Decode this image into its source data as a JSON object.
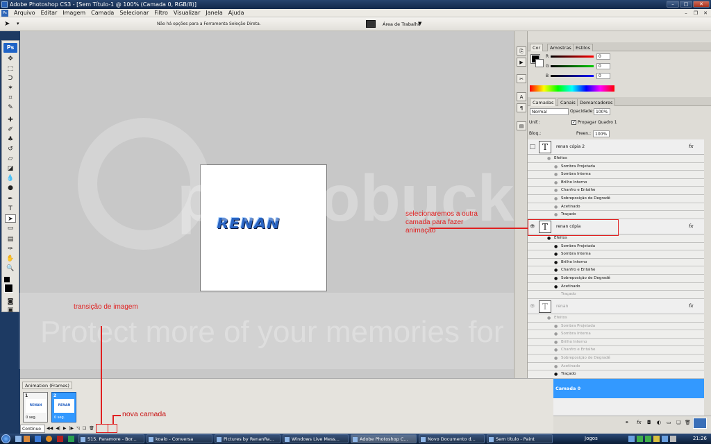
{
  "window": {
    "title": "Adobe Photoshop CS3 - [Sem Título-1 @ 100% (Camada 0, RGB/8)]",
    "min_label": "–",
    "max_label": "□",
    "close_label": "✕"
  },
  "menu": {
    "items": [
      "Arquivo",
      "Editar",
      "Imagem",
      "Camada",
      "Selecionar",
      "Filtro",
      "Visualizar",
      "Janela",
      "Ajuda"
    ]
  },
  "options_bar": {
    "message": "Não há opções para a Ferramenta Seleção Direta.",
    "workspace_label": "Área de Trabalho"
  },
  "toolbar": {
    "logo": "Ps"
  },
  "document": {
    "logo_text": "RENAN"
  },
  "watermark": {
    "main": "photobucket",
    "protect": "Protect more of your memories for less!"
  },
  "annotations": {
    "transition": "transição de imagem",
    "new_layer": "nova camada",
    "select_layer": "selecionaremos a outra camada para fazer animação"
  },
  "color_panel": {
    "tabs": [
      "Cor",
      "Amostras",
      "Estilos"
    ],
    "channels": [
      {
        "label": "R",
        "value": "0",
        "color": "#ff0000"
      },
      {
        "label": "G",
        "value": "0",
        "color": "#00c000"
      },
      {
        "label": "B",
        "value": "0",
        "color": "#0000ff"
      }
    ]
  },
  "layers_panel": {
    "tabs": [
      "Camadas",
      "Canais",
      "Demarcadores"
    ],
    "blend_mode": "Normal",
    "opacity_label": "Opacidade:",
    "opacity_value": "100%",
    "unify_label": "Unif.:",
    "propagate_label": "Propagar Quadro 1",
    "lock_label": "Bloq.:",
    "fill_label": "Preen.:",
    "fill_value": "100%",
    "layers": [
      {
        "name": "renan cópia 2",
        "fx": "fx",
        "effects_label": "Efeitos",
        "effects": [
          "Sombra Projetada",
          "Sombra Interna",
          "Brilho Interno",
          "Chanfro e Entalhe",
          "Sobreposição de Degradê",
          "Acetinado",
          "Traçado"
        ]
      },
      {
        "name": "renan cópia",
        "fx": "fx",
        "effects_label": "Efeitos",
        "effects": [
          "Sombra Projetada",
          "Sombra Interna",
          "Brilho Interno",
          "Chanfro e Entalhe",
          "Sobreposição de Degradê",
          "Acetinado",
          "Traçado"
        ]
      },
      {
        "name": "renan",
        "fx": "fx",
        "effects_label": "Efeitos",
        "effects": [
          "Sombra Projetada",
          "Sombra Interna",
          "Brilho Interno",
          "Chanfro e Entalhe",
          "Sobreposição de Degradê",
          "Acetinado",
          "Traçado"
        ]
      }
    ],
    "selected_layer": "Camada 0",
    "selected_color": "#3399ff"
  },
  "animation_panel": {
    "tab": "Animation (Frames)",
    "frames": [
      {
        "num": "1",
        "time": "0 seg.",
        "thumb": "RENAN"
      },
      {
        "num": "2",
        "time": "0 seg.",
        "thumb": "RENAN"
      }
    ],
    "loop": "Contínuo"
  },
  "taskbar": {
    "items": [
      "515. Paramore - Bor...",
      "koalo - Conversa",
      "Pictures by RenanRa...",
      "Windows Live Mess...",
      "Adobe Photoshop C...",
      "Novo Documento d...",
      "Sem título - Paint"
    ],
    "jogos": "Jogos",
    "clock": "21:26"
  }
}
